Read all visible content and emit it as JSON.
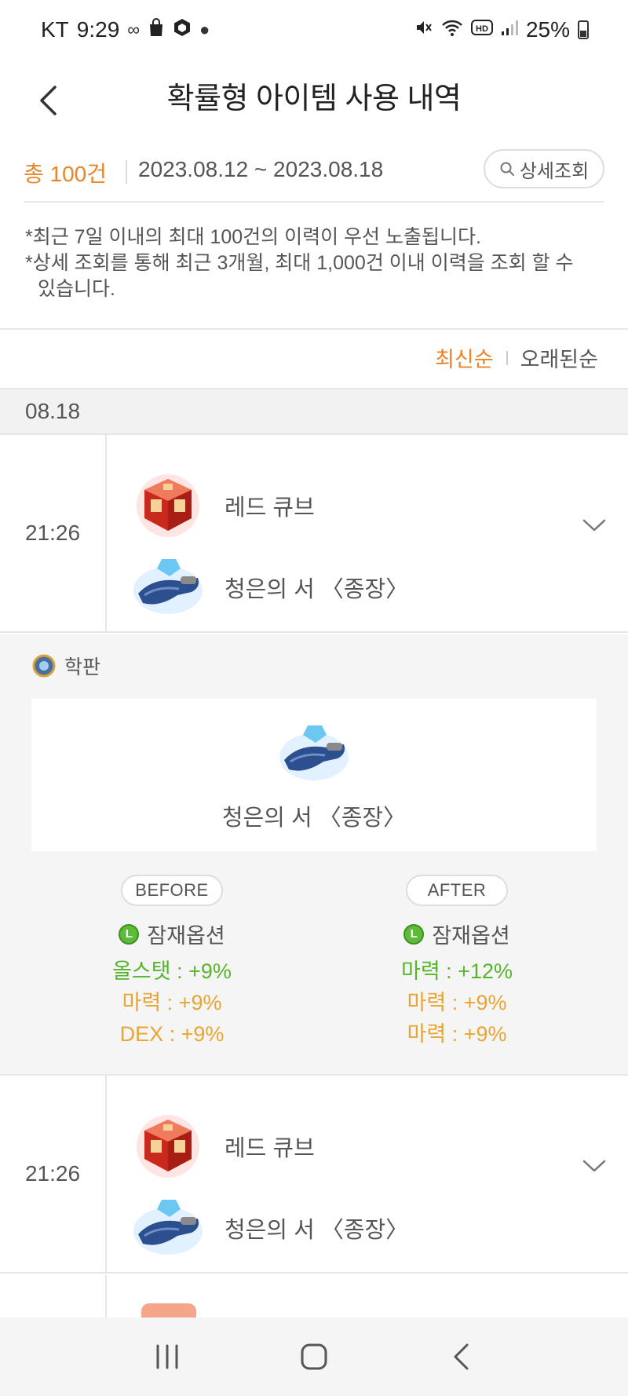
{
  "status_bar": {
    "carrier": "KT",
    "time": "9:29",
    "battery": "25%"
  },
  "header": {
    "title": "확률형 아이템 사용 내역"
  },
  "summary": {
    "total": "총 100건",
    "date_range": "2023.08.12 ~ 2023.08.18",
    "detail_button": "상세조회"
  },
  "notes": [
    "*최근 7일 이내의 최대 100건의 이력이 우선 노출됩니다.",
    "*상세 조회를 통해 최근 3개월, 최대 1,000건 이내 이력을 조회 할 수 있습니다."
  ],
  "sort": {
    "newest": "최신순",
    "oldest": "오래된순"
  },
  "date_group": "08.18",
  "rows": [
    {
      "time": "21:26",
      "item1": "레드 큐브",
      "item2": "청은의 서 〈종장〉"
    },
    {
      "time": "21:26",
      "item1": "레드 큐브",
      "item2": "청은의 서 〈종장〉"
    }
  ],
  "detail": {
    "equipment": "학판",
    "target_item": "청은의 서 〈종장〉",
    "before": {
      "label": "BEFORE",
      "potential": "잠재옵션",
      "options": [
        "올스탯 : +9%",
        "마력 : +9%",
        "DEX : +9%"
      ]
    },
    "after": {
      "label": "AFTER",
      "potential": "잠재옵션",
      "options": [
        "마력 : +12%",
        "마력 : +9%",
        "마력 : +9%"
      ]
    },
    "badge_letter": "L"
  },
  "colors": {
    "accent_orange": "#e8842a",
    "option_green": "#56b52a",
    "option_orange": "#e8a532"
  }
}
